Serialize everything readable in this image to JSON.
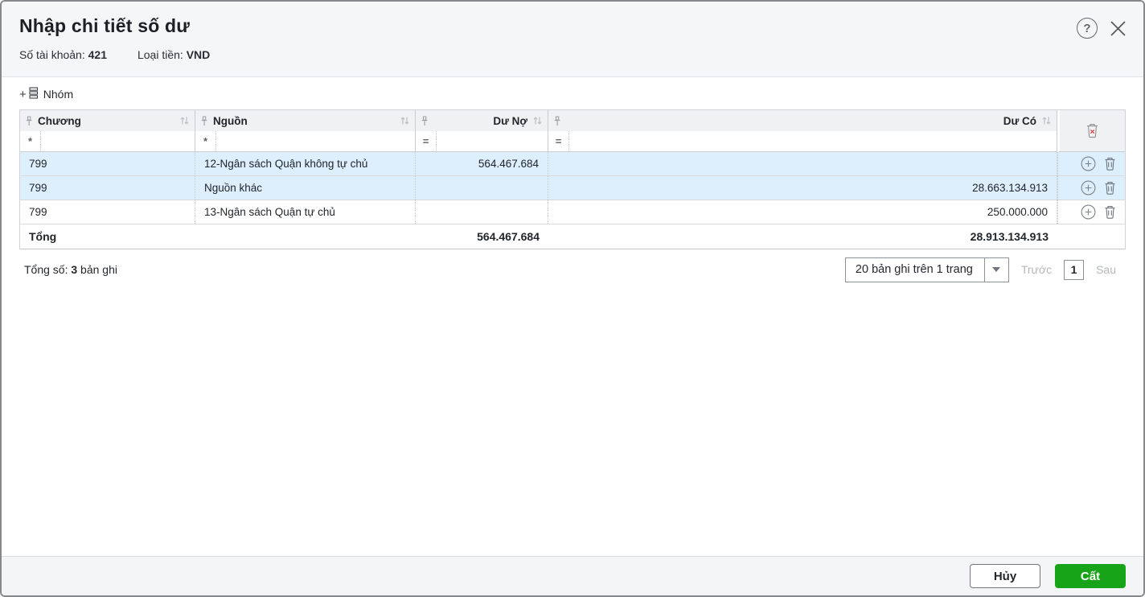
{
  "dialog": {
    "title": "Nhập chi tiết số dư",
    "account_label": "Số tài khoản:",
    "account_value": "421",
    "currency_label": "Loại tiền:",
    "currency_value": "VND"
  },
  "toolbar": {
    "group_plus": "+",
    "group_label": "Nhóm"
  },
  "table": {
    "columns": [
      {
        "label": "Chương",
        "filter_prefix": "*"
      },
      {
        "label": "Nguồn",
        "filter_prefix": "*"
      },
      {
        "label": "Dư Nợ",
        "filter_prefix": "="
      },
      {
        "label": "Dư Có",
        "filter_prefix": "="
      }
    ],
    "rows": [
      {
        "chuong": "799",
        "nguon": "12-Ngân sách Quận không tự chủ",
        "du_no": "564.467.684",
        "du_co": ""
      },
      {
        "chuong": "799",
        "nguon": "Nguồn khác",
        "du_no": "",
        "du_co": "28.663.134.913"
      },
      {
        "chuong": "799",
        "nguon": "13-Ngân sách Quận tự chủ",
        "du_no": "",
        "du_co": "250.000.000"
      }
    ],
    "totals": {
      "label": "Tổng",
      "du_no": "564.467.684",
      "du_co": "28.913.134.913"
    }
  },
  "pagination": {
    "summary_label": "Tổng số:",
    "summary_count": "3",
    "summary_suffix": " bản ghi",
    "page_size_value": "20 bản ghi trên 1 trang",
    "prev_label": "Trước",
    "current_page": "1",
    "next_label": "Sau"
  },
  "footer": {
    "cancel_label": "Hủy",
    "save_label": "Cất"
  },
  "icons": {
    "help": "?",
    "close": "close-icon",
    "pin": "pin-icon",
    "sort": "sort-icon",
    "clear_filters": "trash-clear-icon",
    "add_row": "circle-plus-icon",
    "delete_row": "trash-icon"
  },
  "colors": {
    "accent_green": "#18a418",
    "row_highlight": "#ddeefc",
    "table_header_bg": "#f0f1f3",
    "clear_x_red": "#e23b3b"
  }
}
